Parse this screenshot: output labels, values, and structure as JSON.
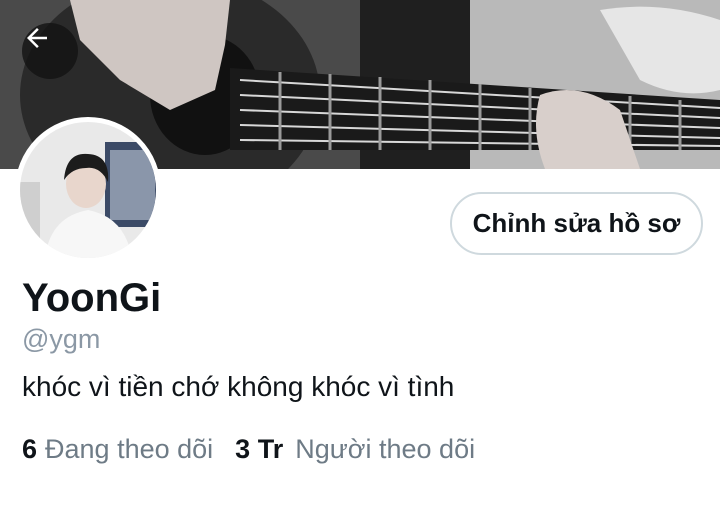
{
  "header": {
    "banner_description": "guitar",
    "back_icon": "arrow-left-icon"
  },
  "profile": {
    "display_name": "YoonGi",
    "handle": "@ygm",
    "bio": "khóc vì tiền chớ không khóc vì tình",
    "edit_button_label": "Chỉnh sửa hồ sơ"
  },
  "stats": {
    "following_count": "6",
    "following_label": "Đang theo dõi",
    "followers_count": "3 Tr",
    "followers_label": "Người theo dõi"
  },
  "colors": {
    "text_primary": "#0f1419",
    "text_secondary": "#8b98a5",
    "button_border": "#cfd9de"
  }
}
